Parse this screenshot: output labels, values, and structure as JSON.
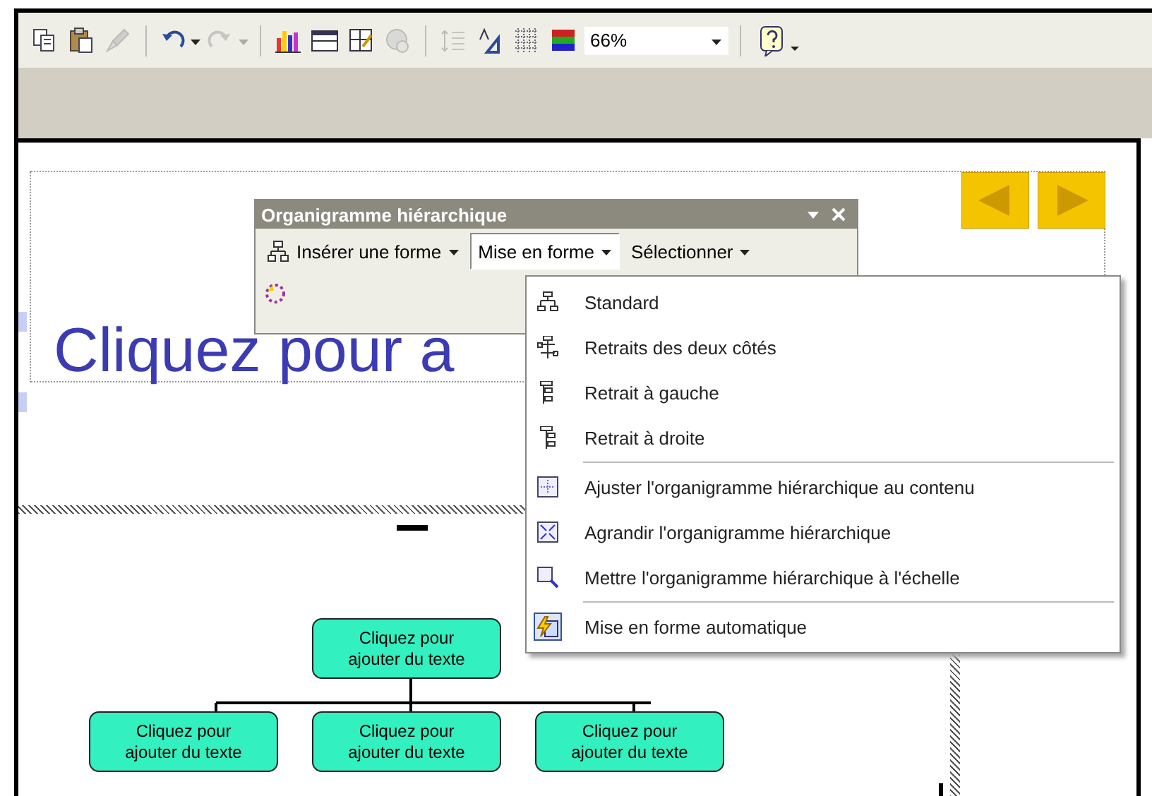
{
  "toolbar": {
    "buttons": [
      {
        "kind": "copy",
        "disabled": false
      },
      {
        "kind": "paste",
        "disabled": false
      },
      {
        "kind": "brush",
        "disabled": true
      },
      {
        "kind": "sep"
      },
      {
        "kind": "undo",
        "disabled": false
      },
      {
        "kind": "redo",
        "disabled": true
      },
      {
        "kind": "sep"
      },
      {
        "kind": "chart",
        "disabled": false
      },
      {
        "kind": "table",
        "disabled": false
      },
      {
        "kind": "tables",
        "disabled": false
      },
      {
        "kind": "globe",
        "disabled": true
      },
      {
        "kind": "sep"
      },
      {
        "kind": "expand",
        "disabled": true
      },
      {
        "kind": "text",
        "disabled": false
      },
      {
        "kind": "grid",
        "disabled": false
      },
      {
        "kind": "color",
        "disabled": false
      }
    ],
    "zoom": {
      "value": "66%"
    }
  },
  "slide": {
    "title_placeholder": "Cliquez pour a"
  },
  "org_toolbar": {
    "title": "Organigramme hiérarchique",
    "buttons": [
      {
        "label": "Insérer une forme",
        "kind": "insert",
        "pressed": false
      },
      {
        "label": "Mise en forme",
        "kind": "menu",
        "pressed": true
      },
      {
        "label": "Sélectionner",
        "kind": "menu",
        "pressed": false
      }
    ]
  },
  "menu": {
    "groups": [
      [
        {
          "label": "Standard",
          "kind": "standard",
          "checked": false
        },
        {
          "label": "Retraits des deux côtés",
          "kind": "both",
          "checked": false
        },
        {
          "label": "Retrait à gauche",
          "kind": "left",
          "checked": false
        },
        {
          "label": "Retrait à droite",
          "kind": "right",
          "checked": false
        }
      ],
      [
        {
          "label": "Ajuster l'organigramme hiérarchique au contenu",
          "kind": "fit",
          "checked": false
        },
        {
          "label": "Agrandir l'organigramme hiérarchique",
          "kind": "expand",
          "checked": false
        },
        {
          "label": "Mettre l'organigramme hiérarchique à l'échelle",
          "kind": "scale",
          "checked": false
        }
      ],
      [
        {
          "label": "Mise en forme automatique",
          "kind": "auto",
          "checked": true
        }
      ]
    ]
  },
  "org_chart": {
    "root": {
      "text": "Cliquez pour ajouter du texte",
      "children": [
        {
          "text": "Cliquez pour ajouter du texte"
        },
        {
          "text": "Cliquez pour ajouter du texte"
        },
        {
          "text": "Cliquez pour ajouter du texte"
        }
      ]
    }
  }
}
